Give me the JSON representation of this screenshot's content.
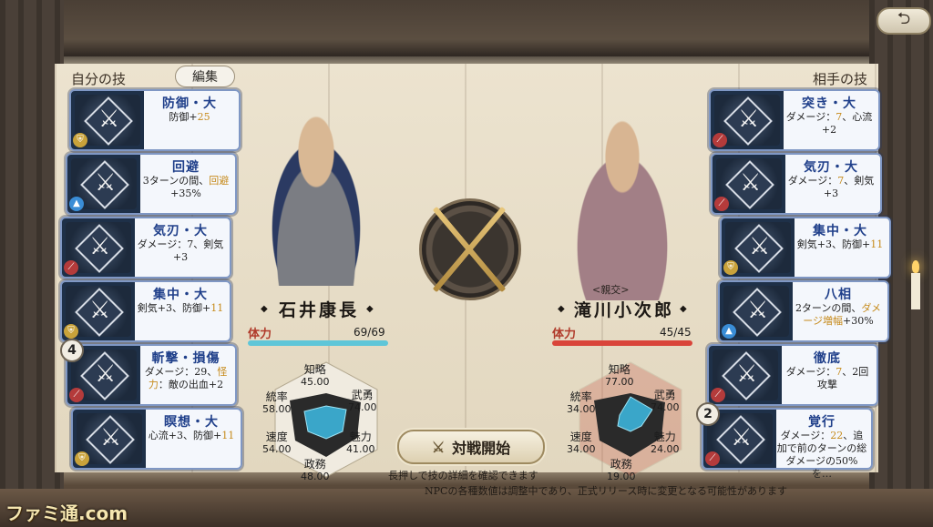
{
  "header": {
    "back_icon": "return-arrow-icon",
    "back_glyph": "⮌"
  },
  "left_panel": {
    "title": "自分の技",
    "edit_label": "編集"
  },
  "right_panel": {
    "title": "相手の技"
  },
  "left_cards": [
    {
      "name": "防御・大",
      "desc_a": "防御+",
      "desc_hl": "25",
      "desc_b": "",
      "badge": "shield-icon"
    },
    {
      "name": "回避",
      "desc_a": "3ターンの間、",
      "desc_hl": "回避",
      "desc_b": "+35%",
      "badge": "arrow-up-icon"
    },
    {
      "name": "気刃・大",
      "desc_a": "ダメージ：7、",
      "desc_hl": "",
      "desc_b": "剣気+3",
      "badge": "sword-icon"
    },
    {
      "name": "集中・大",
      "desc_a": "剣気+3、防御+",
      "desc_hl": "11",
      "desc_b": "",
      "badge": "shield-icon"
    },
    {
      "name": "斬撃・損傷",
      "desc_a": "ダメージ：29、",
      "desc_hl": "怪力",
      "desc_b": "：敵の出血+2",
      "badge": "sword-icon",
      "count": "4"
    },
    {
      "name": "瞑想・大",
      "desc_a": "心流+3、防御+",
      "desc_hl": "11",
      "desc_b": "",
      "badge": "shield-icon"
    }
  ],
  "right_cards": [
    {
      "name": "突き・大",
      "desc_a": "ダメージ：",
      "desc_hl": "7",
      "desc_b": "、心流+2",
      "badge": "sword-icon"
    },
    {
      "name": "気刃・大",
      "desc_a": "ダメージ：",
      "desc_hl": "7",
      "desc_b": "、剣気+3",
      "badge": "sword-icon"
    },
    {
      "name": "集中・大",
      "desc_a": "剣気+3、防御+",
      "desc_hl": "11",
      "desc_b": "",
      "badge": "shield-icon"
    },
    {
      "name": "八相",
      "desc_a": "2ターンの間、",
      "desc_hl": "ダメージ増幅",
      "desc_b": "+30%",
      "badge": "arrow-up-icon"
    },
    {
      "name": "徹底",
      "desc_a": "ダメージ：",
      "desc_hl": "7",
      "desc_b": "、2回攻撃",
      "badge": "sword-icon"
    },
    {
      "name": "覚行",
      "desc_a": "ダメージ：",
      "desc_hl": "22",
      "desc_b": "、追加で前のターンの総ダメージの50%を…",
      "badge": "sword-icon",
      "count": "2"
    }
  ],
  "player": {
    "name": "石井康長",
    "hp_label": "体力",
    "hp_text": "69/69",
    "hp_fraction": 1.0,
    "stats": {
      "chiryaku": "45.00",
      "buyu": "74.00",
      "miryoku": "41.00",
      "seimu": "48.00",
      "sokudo": "54.00",
      "tosotsu": "58.00"
    }
  },
  "enemy": {
    "name": "滝川小次郎",
    "title": "<親交>",
    "hp_label": "体力",
    "hp_text": "45/45",
    "hp_fraction": 1.0,
    "stats": {
      "chiryaku": "77.00",
      "buyu": "74.00",
      "miryoku": "24.00",
      "seimu": "19.00",
      "sokudo": "34.00",
      "tosotsu": "34.00"
    }
  },
  "stat_labels": {
    "chiryaku": "知略",
    "buyu": "武勇",
    "miryoku": "魅力",
    "seimu": "政務",
    "sokudo": "速度",
    "tosotsu": "統率"
  },
  "battle": {
    "start_label": "対戦開始",
    "start_icon": "crossed-swords-icon"
  },
  "hints": {
    "press": "長押しで技の詳細を確認できます",
    "npc": "NPCの各種数値は調整中であり、正式リリース時に変更となる可能性があります"
  },
  "watermark": "ファミ通.com",
  "colors": {
    "player_hp": "#5fc6d8",
    "enemy_hp": "#d9453a",
    "card_title": "#1f3f8a",
    "highlight": "#c68a1a"
  }
}
